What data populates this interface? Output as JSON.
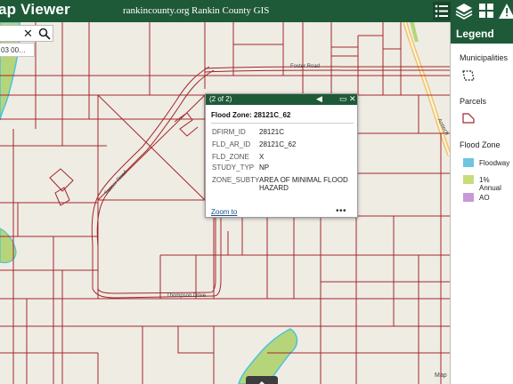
{
  "header": {
    "title": "ap Viewer",
    "link_site": "rankincounty.org",
    "link_gis": "Rankin County GIS",
    "icons": [
      "list-icon",
      "layers-icon",
      "grid-icon",
      "alert-icon"
    ]
  },
  "search": {
    "value": "",
    "clear_symbol": "✕",
    "suggestion": "03 00…"
  },
  "popup": {
    "counter": "(2 of 2)",
    "title": "Flood Zone: 28121C_62",
    "attributes": [
      {
        "key": "DFIRM_ID",
        "value": "28121C"
      },
      {
        "key": "FLD_AR_ID",
        "value": "28121C_62"
      },
      {
        "key": "FLD_ZONE",
        "value": "X"
      },
      {
        "key": "STUDY_TYP",
        "value": "NP"
      },
      {
        "key": "ZONE_SUBTY",
        "value": "AREA OF MINIMAL FLOOD HAZARD"
      }
    ],
    "zoom_link": "Zoom to",
    "more": "•••"
  },
  "legend": {
    "title": "Legend",
    "groups": [
      {
        "label": "Municipalities",
        "items": []
      },
      {
        "label": "Parcels",
        "items": []
      },
      {
        "label": "Flood Zone",
        "items": [
          {
            "label": "Floodway",
            "color": "#6fc4e0"
          },
          {
            "label": "1% Annual",
            "color": "#c8dc7a"
          },
          {
            "label": "AO",
            "color": "#c79ad6"
          }
        ]
      }
    ]
  },
  "map": {
    "road_labels": [
      "Foster Road",
      "Thompson Drive",
      "Sasser Road",
      "Antioch"
    ],
    "bottom_label": "Map"
  },
  "colors": {
    "header": "#1f5a38",
    "parcel": "#a3272b",
    "basemap": "#efece4",
    "green_area": "#b6d57a",
    "water_edge": "#4cc3d8",
    "road_casing": "#f0c36b"
  }
}
